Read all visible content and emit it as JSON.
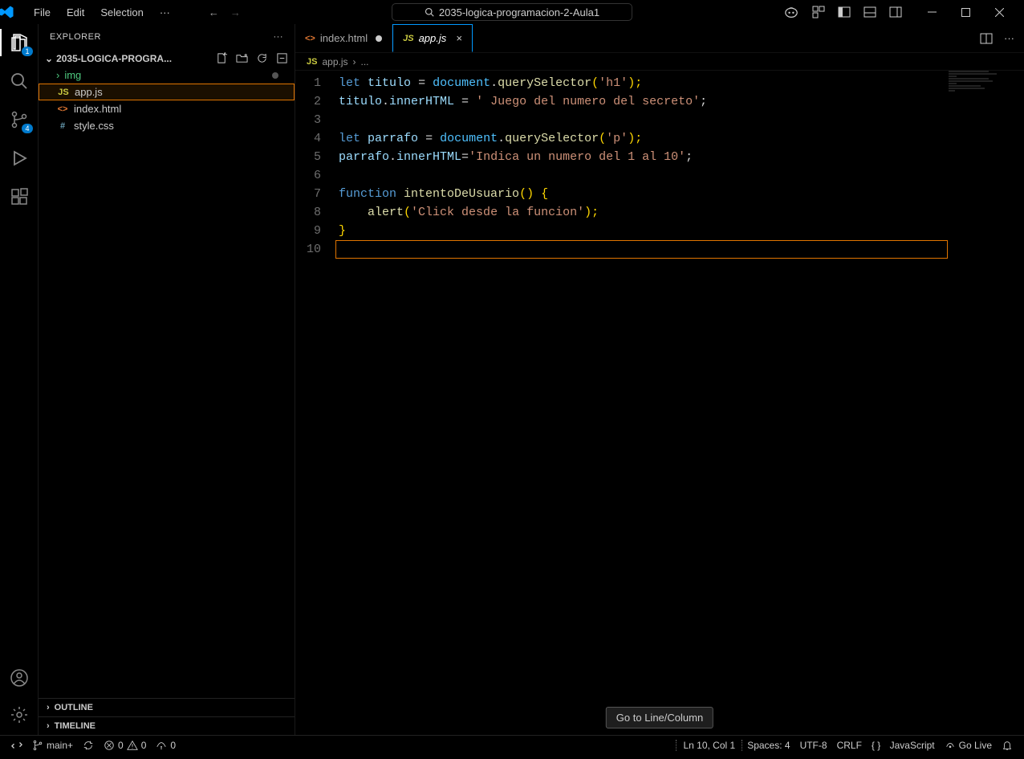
{
  "titlebar": {
    "menus": [
      "File",
      "Edit",
      "Selection"
    ],
    "search_text": "2035-logica-programacion-2-Aula1"
  },
  "activitybar": {
    "explorer_badge": "1",
    "scm_badge": "4"
  },
  "sidebar": {
    "title": "EXPLORER",
    "folder": "2035-LOGICA-PROGRA...",
    "items": [
      {
        "name": "img",
        "type": "folder"
      },
      {
        "name": "app.js",
        "type": "js"
      },
      {
        "name": "index.html",
        "type": "html"
      },
      {
        "name": "style.css",
        "type": "css"
      }
    ],
    "outline": "OUTLINE",
    "timeline": "TIMELINE"
  },
  "tabs": [
    {
      "name": "index.html",
      "type": "html",
      "dirty": true
    },
    {
      "name": "app.js",
      "type": "js",
      "active": true
    }
  ],
  "breadcrumb": {
    "file": "app.js",
    "rest": "..."
  },
  "code_lines": [
    "1",
    "2",
    "3",
    "4",
    "5",
    "6",
    "7",
    "8",
    "9",
    "10"
  ],
  "code": {
    "l1a": "let",
    "l1b": "titulo",
    "l1c": "=",
    "l1d": "document",
    "l1e": ".",
    "l1f": "querySelector",
    "l1g": "(",
    "l1h": "'h1'",
    "l1i": ");",
    "l2a": "titulo",
    "l2b": ".",
    "l2c": "innerHTML",
    "l2d": " = ",
    "l2e": "' Juego del numero del secreto'",
    "l2f": ";",
    "l4a": "let",
    "l4b": "parrafo",
    "l4c": "=",
    "l4d": "document",
    "l4e": ".",
    "l4f": "querySelector",
    "l4g": "(",
    "l4h": "'p'",
    "l4i": ");",
    "l5a": "parrafo",
    "l5b": ".",
    "l5c": "innerHTML",
    "l5d": "=",
    "l5e": "'Indica un numero del 1 al 10'",
    "l5f": ";",
    "l7a": "function",
    "l7b": "intentoDeUsuario",
    "l7c": "()",
    "l7d": "{",
    "l8a": "alert",
    "l8b": "(",
    "l8c": "'Click desde la funcion'",
    "l8d": ");",
    "l9a": "}"
  },
  "tooltip": "Go to Line/Column",
  "statusbar": {
    "branch": "main+",
    "errors": "0",
    "warnings": "0",
    "ports": "0",
    "lncol": "Ln 10, Col 1",
    "spaces": "Spaces: 4",
    "encoding": "UTF-8",
    "eol": "CRLF",
    "lang": "JavaScript",
    "golive": "Go Live"
  }
}
